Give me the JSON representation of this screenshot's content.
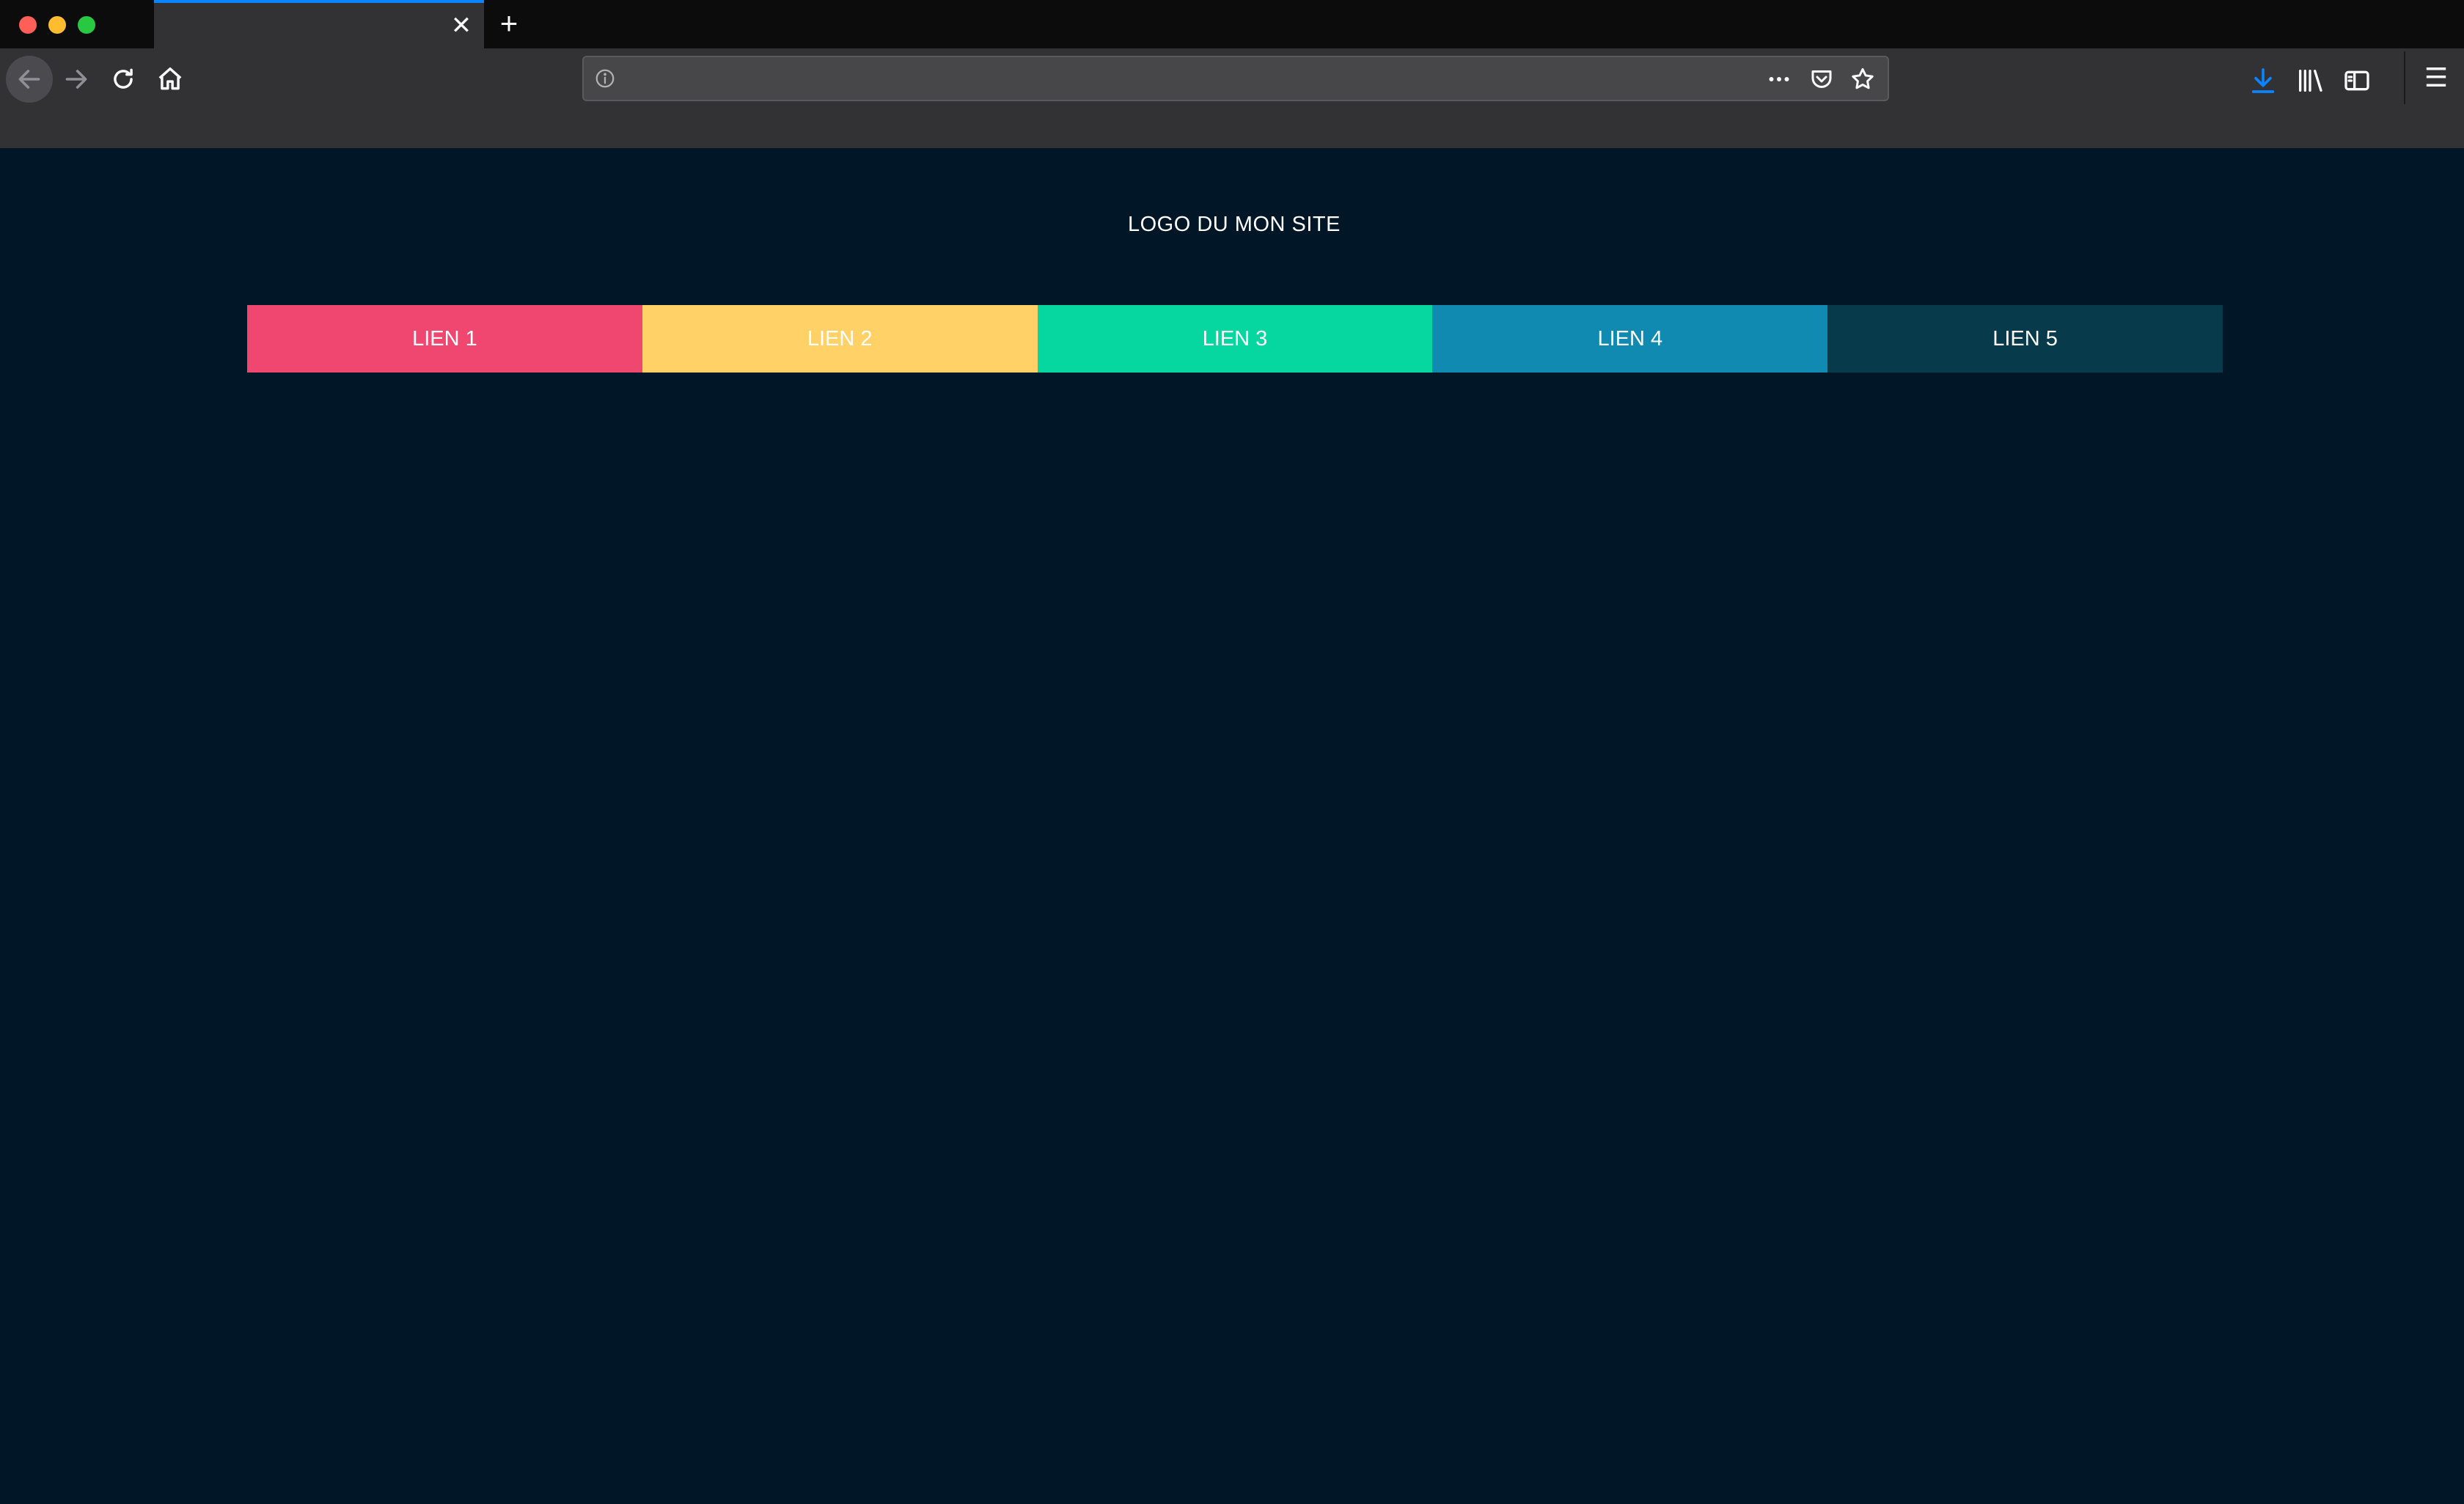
{
  "browser": {
    "tab": {
      "close_glyph": "✕"
    },
    "new_tab_glyph": "+",
    "urlbar": {
      "value": "",
      "placeholder": ""
    },
    "toolbar": {
      "menu_glyph": "☰"
    },
    "icons": {
      "back": "back-arrow-icon",
      "forward": "forward-arrow-icon",
      "reload": "reload-icon",
      "home": "home-icon",
      "info": "info-icon",
      "page_actions": "more-horizontal-icon",
      "pocket": "pocket-icon",
      "bookmark": "star-icon",
      "downloads": "download-icon",
      "library": "library-icon",
      "sidebar": "sidebar-icon",
      "menu": "hamburger-menu-icon"
    },
    "colors": {
      "tabstrip": "#0c0c0d",
      "toolbar": "#323234",
      "accent": "#0a84ff"
    }
  },
  "page": {
    "logo": "LOGO DU MON SITE",
    "background": "#011627",
    "nav": [
      {
        "label": "LIEN 1",
        "color": "#ef476f"
      },
      {
        "label": "LIEN 2",
        "color": "#ffd166"
      },
      {
        "label": "LIEN 3",
        "color": "#06d6a0"
      },
      {
        "label": "LIEN 4",
        "color": "#118ab2"
      },
      {
        "label": "LIEN 5",
        "color": "#073b4c"
      }
    ]
  }
}
